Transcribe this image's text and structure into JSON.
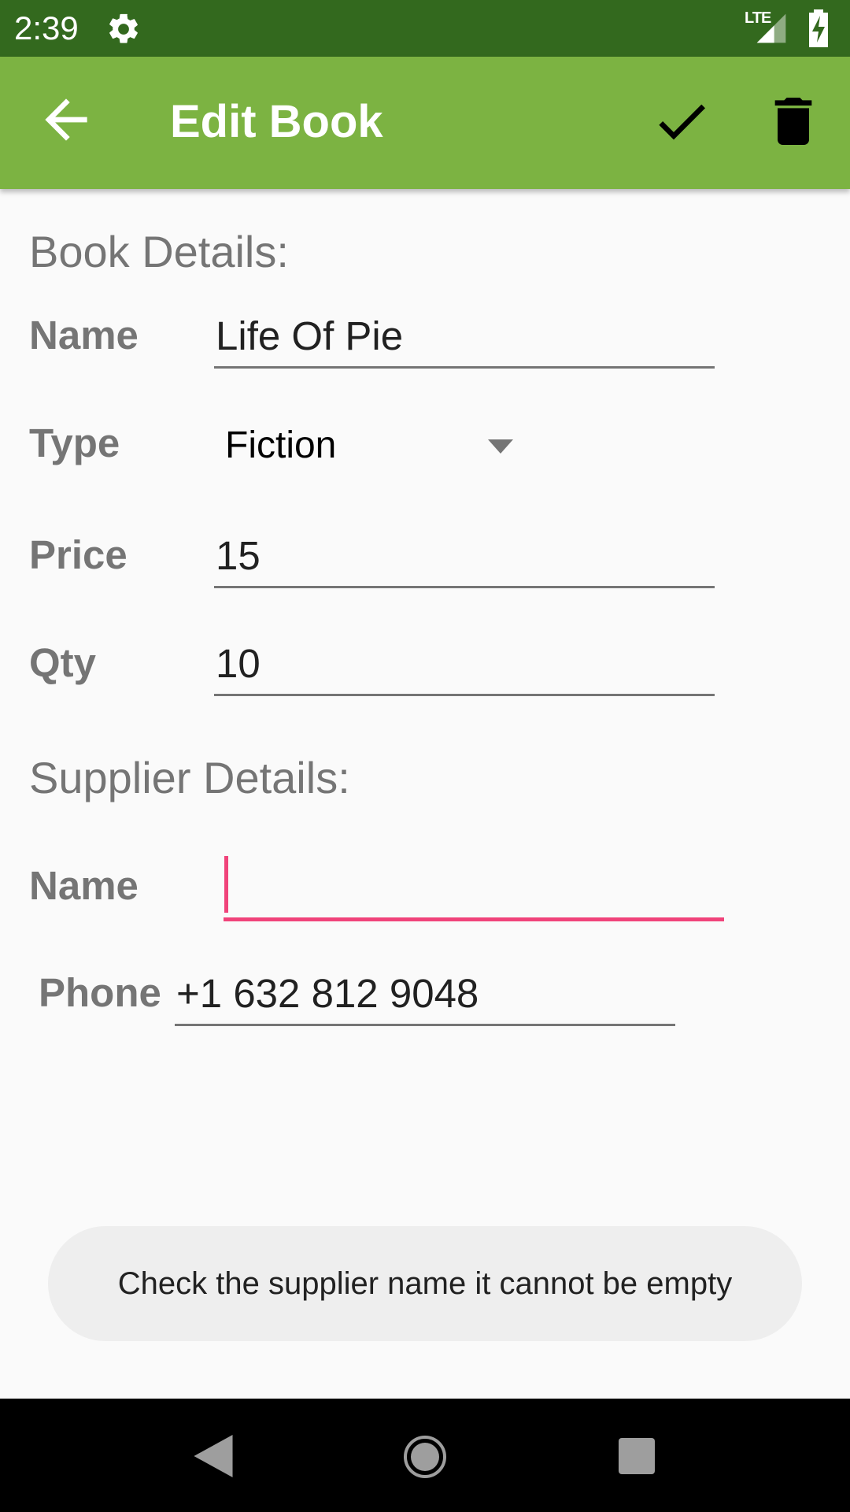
{
  "status_bar": {
    "time": "2:39",
    "network": "LTE"
  },
  "app_bar": {
    "title": "Edit Book"
  },
  "book_details": {
    "heading": "Book Details:",
    "name_label": "Name",
    "name_value": "Life Of Pie",
    "type_label": "Type",
    "type_value": "Fiction",
    "price_label": "Price",
    "price_value": "15",
    "qty_label": "Qty",
    "qty_value": "10"
  },
  "supplier_details": {
    "heading": "Supplier Details:",
    "name_label": "Name",
    "name_value": "",
    "phone_label": "Phone",
    "phone_value": "+1 632 812 9048"
  },
  "toast": {
    "message": "Check the supplier name it cannot be empty"
  },
  "colors": {
    "status_bar": "#33691e",
    "app_bar": "#7cb342",
    "focus_accent": "#f0437a",
    "label_gray": "#757575"
  }
}
